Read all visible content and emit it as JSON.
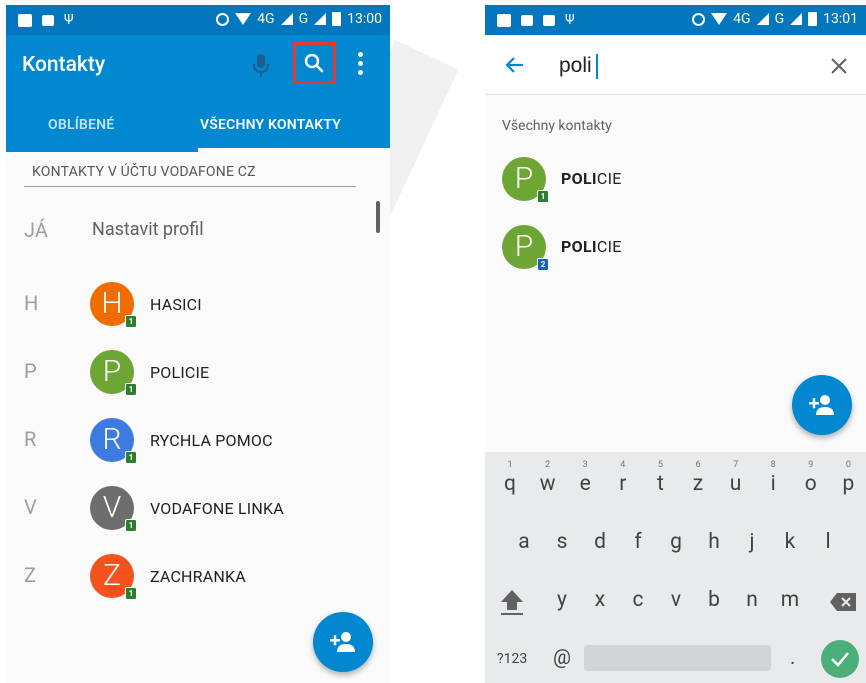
{
  "colors": {
    "status_bar": "#0277bd",
    "app_bar": "#0288d1",
    "highlight_box": "#e53935",
    "avatar_orange": "#ef6c00",
    "avatar_green": "#6ea634",
    "avatar_blue": "#3d7be0",
    "avatar_grey": "#6d6d6d",
    "avatar_red": "#f4511e"
  },
  "phone1": {
    "status": {
      "network": "4G",
      "network2": "G",
      "time": "13:00"
    },
    "app_title": "Kontakty",
    "tabs": [
      {
        "label": "OBLÍBENÉ",
        "active": false
      },
      {
        "label": "VŠECHNY KONTAKTY",
        "active": true
      }
    ],
    "section_header": "KONTAKTY V ÚČTU VODAFONE CZ",
    "me": {
      "letter": "JÁ",
      "label": "Nastavit profil"
    },
    "contacts": [
      {
        "letter": "H",
        "initial": "H",
        "name": "HASICI",
        "color": "orange",
        "badge": "1"
      },
      {
        "letter": "P",
        "initial": "P",
        "name": "POLICIE",
        "color": "green",
        "badge": "1"
      },
      {
        "letter": "R",
        "initial": "R",
        "name": "RYCHLA POMOC",
        "color": "blue",
        "badge": "1"
      },
      {
        "letter": "V",
        "initial": "V",
        "name": "VODAFONE LINKA",
        "color": "grey",
        "badge": "1"
      },
      {
        "letter": "Z",
        "initial": "Z",
        "name": "ZACHRANKA",
        "color": "red",
        "badge": "1"
      }
    ]
  },
  "phone2": {
    "status": {
      "network": "4G",
      "network2": "G",
      "time": "13:01"
    },
    "search": {
      "value": "poli"
    },
    "results_header": "Všechny kontakty",
    "results": [
      {
        "initial": "P",
        "match": "POLI",
        "rest": "CIE",
        "badge": "1",
        "badge_color": "green"
      },
      {
        "initial": "P",
        "match": "POLI",
        "rest": "CIE",
        "badge": "2",
        "badge_color": "blue"
      }
    ],
    "keyboard": {
      "row1": [
        {
          "k": "q",
          "hint": "1"
        },
        {
          "k": "w",
          "hint": "2"
        },
        {
          "k": "e",
          "hint": "3"
        },
        {
          "k": "r",
          "hint": "4"
        },
        {
          "k": "t",
          "hint": "5"
        },
        {
          "k": "z",
          "hint": "6"
        },
        {
          "k": "u",
          "hint": "7"
        },
        {
          "k": "i",
          "hint": "8"
        },
        {
          "k": "o",
          "hint": "9"
        },
        {
          "k": "p",
          "hint": "0"
        }
      ],
      "row2": [
        "a",
        "s",
        "d",
        "f",
        "g",
        "h",
        "j",
        "k",
        "l"
      ],
      "row3": [
        "y",
        "x",
        "c",
        "v",
        "b",
        "n",
        "m"
      ],
      "symbols_label": "?123",
      "at_label": "@",
      "dot_label": "."
    }
  }
}
